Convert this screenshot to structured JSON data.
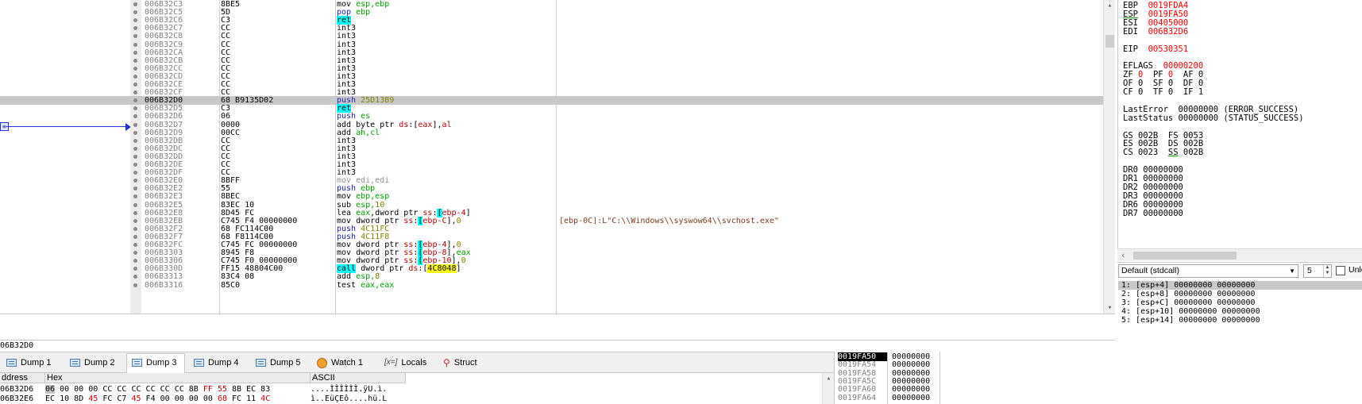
{
  "disasm": {
    "rows": [
      {
        "addr": "006B32C3",
        "bytes": "8BE5",
        "mn": "mov",
        "ops": [
          {
            "t": " esp,ebp",
            "c": "o-reg"
          }
        ],
        "mc": "m-int"
      },
      {
        "addr": "006B32C5",
        "bytes": "5D",
        "mn": "pop",
        "ops": [
          {
            "t": " ebp",
            "c": "o-reg"
          }
        ],
        "mc": "m-push"
      },
      {
        "addr": "006B32C6",
        "bytes": "C3",
        "mn": "ret",
        "ops": [],
        "mc": "m-ret"
      },
      {
        "addr": "006B32C7",
        "bytes": "CC",
        "mn": "int3",
        "ops": [],
        "mc": "m-int"
      },
      {
        "addr": "006B32C8",
        "bytes": "CC",
        "mn": "int3",
        "ops": [],
        "mc": "m-int"
      },
      {
        "addr": "006B32C9",
        "bytes": "CC",
        "mn": "int3",
        "ops": [],
        "mc": "m-int"
      },
      {
        "addr": "006B32CA",
        "bytes": "CC",
        "mn": "int3",
        "ops": [],
        "mc": "m-int"
      },
      {
        "addr": "006B32CB",
        "bytes": "CC",
        "mn": "int3",
        "ops": [],
        "mc": "m-int"
      },
      {
        "addr": "006B32CC",
        "bytes": "CC",
        "mn": "int3",
        "ops": [],
        "mc": "m-int"
      },
      {
        "addr": "006B32CD",
        "bytes": "CC",
        "mn": "int3",
        "ops": [],
        "mc": "m-int"
      },
      {
        "addr": "006B32CE",
        "bytes": "CC",
        "mn": "int3",
        "ops": [],
        "mc": "m-int"
      },
      {
        "addr": "006B32CF",
        "bytes": "CC",
        "mn": "int3",
        "ops": [],
        "mc": "m-int"
      },
      {
        "addr": "006B32D0",
        "bytes": "68 B9135D02",
        "mn": "push",
        "ops": [
          {
            "t": " 25D13B9",
            "c": "o-num"
          }
        ],
        "mc": "m-push",
        "hl": true
      },
      {
        "addr": "006B32D5",
        "bytes": "C3",
        "mn": "ret",
        "ops": [],
        "mc": "m-ret"
      },
      {
        "addr": "006B32D6",
        "bytes": "06",
        "mn": "push",
        "ops": [
          {
            "t": " es",
            "c": "o-reg"
          }
        ],
        "mc": "m-push"
      },
      {
        "addr": "006B32D7",
        "bytes": "0000",
        "mn": "add",
        "ops": [
          {
            "t": " byte ptr ",
            "c": ""
          },
          {
            "t": "ds",
            "c": "o-seg"
          },
          {
            "t": ":[",
            "c": ""
          },
          {
            "t": "eax",
            "c": "o-seg"
          },
          {
            "t": "],",
            "c": ""
          },
          {
            "t": "al",
            "c": "o-seg"
          }
        ],
        "mc": "m-int"
      },
      {
        "addr": "006B32D9",
        "bytes": "00CC",
        "mn": "add",
        "ops": [
          {
            "t": " ah,cl",
            "c": "o-reg"
          }
        ],
        "mc": "m-int"
      },
      {
        "addr": "006B32DB",
        "bytes": "CC",
        "mn": "int3",
        "ops": [],
        "mc": "m-int"
      },
      {
        "addr": "006B32DC",
        "bytes": "CC",
        "mn": "int3",
        "ops": [],
        "mc": "m-int"
      },
      {
        "addr": "006B32DD",
        "bytes": "CC",
        "mn": "int3",
        "ops": [],
        "mc": "m-int"
      },
      {
        "addr": "006B32DE",
        "bytes": "CC",
        "mn": "int3",
        "ops": [],
        "mc": "m-int"
      },
      {
        "addr": "006B32DF",
        "bytes": "CC",
        "mn": "int3",
        "ops": [],
        "mc": "m-int"
      },
      {
        "addr": "006B32E0",
        "bytes": "8BFF",
        "mn": "mov edi,edi",
        "ops": [],
        "mc": "m-gray"
      },
      {
        "addr": "006B32E2",
        "bytes": "55",
        "mn": "push",
        "ops": [
          {
            "t": " ebp",
            "c": "o-reg"
          }
        ],
        "mc": "m-push"
      },
      {
        "addr": "006B32E3",
        "bytes": "8BEC",
        "mn": "mov",
        "ops": [
          {
            "t": " ebp,esp",
            "c": "o-reg"
          }
        ],
        "mc": "m-int"
      },
      {
        "addr": "006B32E5",
        "bytes": "83EC 10",
        "mn": "sub",
        "ops": [
          {
            "t": " esp,",
            "c": "o-reg"
          },
          {
            "t": "10",
            "c": "o-num"
          }
        ],
        "mc": "m-int"
      },
      {
        "addr": "006B32E8",
        "bytes": "8D45 FC",
        "mn": "lea",
        "ops": [
          {
            "t": " eax",
            "c": "o-reg"
          },
          {
            "t": ",dword ptr ",
            "c": ""
          },
          {
            "t": "ss",
            "c": "o-seg"
          },
          {
            "t": ":",
            "c": ""
          },
          {
            "t": "[",
            "c": "o-brk"
          },
          {
            "t": "ebp-4",
            "c": "o-seg"
          },
          {
            "t": "]",
            "c": ""
          }
        ],
        "mc": "m-int"
      },
      {
        "addr": "006B32EB",
        "bytes": "C745 F4 00000000",
        "mn": "mov",
        "ops": [
          {
            "t": " dword ptr ",
            "c": ""
          },
          {
            "t": "ss",
            "c": "o-seg"
          },
          {
            "t": ":",
            "c": ""
          },
          {
            "t": "[",
            "c": "o-brk"
          },
          {
            "t": "ebp-C",
            "c": "o-seg"
          },
          {
            "t": "],",
            "c": ""
          },
          {
            "t": "0",
            "c": "o-num"
          }
        ],
        "mc": "m-int",
        "cmt": "[ebp-0C]:L\"C:\\\\Windows\\\\syswow64\\\\svchost.exe\""
      },
      {
        "addr": "006B32F2",
        "bytes": "68 FC114C00",
        "mn": "push",
        "ops": [
          {
            "t": " 4C11FC",
            "c": "o-num"
          }
        ],
        "mc": "m-push"
      },
      {
        "addr": "006B32F7",
        "bytes": "68 F8114C00",
        "mn": "push",
        "ops": [
          {
            "t": " 4C11F8",
            "c": "o-num"
          }
        ],
        "mc": "m-push"
      },
      {
        "addr": "006B32FC",
        "bytes": "C745 FC 00000000",
        "mn": "mov",
        "ops": [
          {
            "t": " dword ptr ",
            "c": ""
          },
          {
            "t": "ss",
            "c": "o-seg"
          },
          {
            "t": ":",
            "c": ""
          },
          {
            "t": "[",
            "c": "o-brk"
          },
          {
            "t": "ebp-4",
            "c": "o-seg"
          },
          {
            "t": "],",
            "c": ""
          },
          {
            "t": "0",
            "c": "o-num"
          }
        ],
        "mc": "m-int"
      },
      {
        "addr": "006B3303",
        "bytes": "8945 F8",
        "mn": "mov",
        "ops": [
          {
            "t": " dword ptr ",
            "c": ""
          },
          {
            "t": "ss",
            "c": "o-seg"
          },
          {
            "t": ":",
            "c": ""
          },
          {
            "t": "[",
            "c": "o-brk"
          },
          {
            "t": "ebp-8",
            "c": "o-seg"
          },
          {
            "t": "],",
            "c": ""
          },
          {
            "t": "eax",
            "c": "o-reg"
          }
        ],
        "mc": "m-int"
      },
      {
        "addr": "006B3306",
        "bytes": "C745 F0 00000000",
        "mn": "mov",
        "ops": [
          {
            "t": " dword ptr ",
            "c": ""
          },
          {
            "t": "ss",
            "c": "o-seg"
          },
          {
            "t": ":",
            "c": ""
          },
          {
            "t": "[",
            "c": "o-brk"
          },
          {
            "t": "ebp-10",
            "c": "o-seg"
          },
          {
            "t": "],",
            "c": ""
          },
          {
            "t": "0",
            "c": "o-num"
          }
        ],
        "mc": "m-int"
      },
      {
        "addr": "006B330D",
        "bytes": "FF15 48804C00",
        "mn": "call",
        "ops": [
          {
            "t": " dword ptr ",
            "c": ""
          },
          {
            "t": "ds",
            "c": "o-seg"
          },
          {
            "t": ":[",
            "c": ""
          },
          {
            "t": "4C8048",
            "c": "o-addr"
          },
          {
            "t": "]",
            "c": ""
          }
        ],
        "mc": "m-call"
      },
      {
        "addr": "006B3313",
        "bytes": "83C4 08",
        "mn": "add",
        "ops": [
          {
            "t": " esp,",
            "c": "o-reg"
          },
          {
            "t": "8",
            "c": "o-num"
          }
        ],
        "mc": "m-int"
      },
      {
        "addr": "006B3316",
        "bytes": "85C0",
        "mn": "test",
        "ops": [
          {
            "t": " eax,eax",
            "c": "o-reg"
          }
        ],
        "mc": "m-int"
      }
    ],
    "arrow_label": "EDI"
  },
  "address_bar": "06B32D0",
  "registers": {
    "lines": [
      {
        "parts": [
          {
            "t": "EBP  ",
            "c": "rname"
          },
          {
            "t": "0019FDA4",
            "c": "rval"
          }
        ]
      },
      {
        "parts": [
          {
            "t": "ESP",
            "c": "rname ul"
          },
          {
            "t": "  ",
            "c": "rname"
          },
          {
            "t": "0019FA50",
            "c": "rval"
          }
        ]
      },
      {
        "parts": [
          {
            "t": "ESI  ",
            "c": "rname"
          },
          {
            "t": "00405000",
            "c": "rval"
          }
        ]
      },
      {
        "parts": [
          {
            "t": "EDI  ",
            "c": "rname"
          },
          {
            "t": "006B32D6",
            "c": "rval"
          }
        ]
      },
      {
        "parts": []
      },
      {
        "parts": [
          {
            "t": "EIP  ",
            "c": "rname"
          },
          {
            "t": "00530351",
            "c": "rval"
          }
        ]
      },
      {
        "parts": []
      },
      {
        "parts": [
          {
            "t": "EFLAGS  ",
            "c": "rname"
          },
          {
            "t": "00000200",
            "c": "rval"
          }
        ]
      },
      {
        "parts": [
          {
            "t": "ZF ",
            "c": "rname"
          },
          {
            "t": "0",
            "c": "rval"
          },
          {
            "t": "  PF ",
            "c": "rname"
          },
          {
            "t": "0",
            "c": "rval"
          },
          {
            "t": "  AF 0",
            "c": "rname"
          }
        ]
      },
      {
        "parts": [
          {
            "t": "OF 0  SF 0  DF 0",
            "c": "rname"
          }
        ]
      },
      {
        "parts": [
          {
            "t": "CF 0  TF 0  IF 1",
            "c": "rname"
          }
        ]
      },
      {
        "parts": []
      },
      {
        "parts": [
          {
            "t": "LastError  00000000 (ERROR_SUCCESS)",
            "c": "rname"
          }
        ]
      },
      {
        "parts": [
          {
            "t": "LastStatus 00000000 (STATUS_SUCCESS)",
            "c": "rname"
          }
        ]
      },
      {
        "parts": []
      },
      {
        "parts": [
          {
            "t": "GS 002B  FS 0053",
            "c": "rname"
          }
        ]
      },
      {
        "parts": [
          {
            "t": "ES 002B  DS 002B",
            "c": "rname"
          }
        ]
      },
      {
        "parts": [
          {
            "t": "CS 0023  ",
            "c": "rname"
          },
          {
            "t": "SS",
            "c": "rname ul"
          },
          {
            "t": " 002B",
            "c": "rname"
          }
        ]
      },
      {
        "parts": []
      },
      {
        "parts": [
          {
            "t": "DR0 00000000",
            "c": "rname"
          }
        ]
      },
      {
        "parts": [
          {
            "t": "DR1 00000000",
            "c": "rname"
          }
        ]
      },
      {
        "parts": [
          {
            "t": "DR2 00000000",
            "c": "rname"
          }
        ]
      },
      {
        "parts": [
          {
            "t": "DR3 00000000",
            "c": "rname"
          }
        ]
      },
      {
        "parts": [
          {
            "t": "DR6 00000000",
            "c": "rname"
          }
        ]
      },
      {
        "parts": [
          {
            "t": "DR7 00000000",
            "c": "rname"
          }
        ]
      }
    ]
  },
  "callconv": {
    "selected": "Default (stdcall)",
    "count": "5",
    "unlock_label": "Unlo"
  },
  "args": [
    "1: [esp+4] 00000000 00000000",
    "2: [esp+8] 00000000 00000000",
    "3: [esp+C] 00000000 00000000",
    "4: [esp+10] 00000000 00000000",
    "5: [esp+14] 00000000 00000000"
  ],
  "tabs": [
    {
      "label": "Dump 1",
      "icon": "dump-icon"
    },
    {
      "label": "Dump 2",
      "icon": "dump-icon"
    },
    {
      "label": "Dump 3",
      "icon": "dump-icon",
      "active": true
    },
    {
      "label": "Dump 4",
      "icon": "dump-icon"
    },
    {
      "label": "Dump 5",
      "icon": "dump-icon"
    },
    {
      "label": "Watch 1",
      "icon": "watch-icon"
    },
    {
      "label": "Locals",
      "icon": "locals-icon",
      "icon_text": "[x=]"
    },
    {
      "label": "Struct",
      "icon": "struct-icon",
      "icon_text": "⚲"
    }
  ],
  "dump": {
    "headers": {
      "address": "ddress",
      "hex": "Hex",
      "ascii": "ASCII"
    },
    "rows": [
      {
        "addr": "06B32D6",
        "bytes": [
          [
            "06",
            "b-cur"
          ],
          [
            "00",
            ""
          ],
          [
            "00",
            ""
          ],
          [
            "00",
            ""
          ],
          [
            "CC",
            ""
          ],
          [
            "CC",
            ""
          ],
          [
            "CC",
            ""
          ],
          [
            "CC",
            ""
          ],
          [
            "CC",
            ""
          ],
          [
            "CC",
            ""
          ],
          [
            "8B",
            ""
          ],
          [
            "FF",
            "b-red"
          ],
          [
            "55",
            "b-red"
          ],
          [
            "8B",
            ""
          ],
          [
            "EC",
            ""
          ],
          [
            "83",
            ""
          ]
        ],
        "ascii": "....ÌÌÌÌÌÌ.ÿU.ì."
      },
      {
        "addr": "06B32E6",
        "bytes": [
          [
            "EC",
            ""
          ],
          [
            "10",
            ""
          ],
          [
            "8D",
            ""
          ],
          [
            "45",
            "b-red"
          ],
          [
            "FC",
            ""
          ],
          [
            "C7",
            ""
          ],
          [
            "45",
            "b-red"
          ],
          [
            "F4",
            ""
          ],
          [
            "00",
            ""
          ],
          [
            "00",
            ""
          ],
          [
            "00",
            ""
          ],
          [
            "00",
            ""
          ],
          [
            "68",
            "b-red"
          ],
          [
            "FC",
            ""
          ],
          [
            "11",
            ""
          ],
          [
            "4C",
            "b-red"
          ]
        ],
        "ascii": "ì..EüÇEô....hü.L"
      }
    ]
  },
  "stack": [
    {
      "addr": "0019FA50",
      "val": "00000000",
      "top": true
    },
    {
      "addr": "0019FA54",
      "val": "00000000"
    },
    {
      "addr": "0019FA58",
      "val": "00000000"
    },
    {
      "addr": "0019FA5C",
      "val": "00000000"
    },
    {
      "addr": "0019FA60",
      "val": "00000000"
    },
    {
      "addr": "0019FA64",
      "val": "00000000"
    }
  ]
}
